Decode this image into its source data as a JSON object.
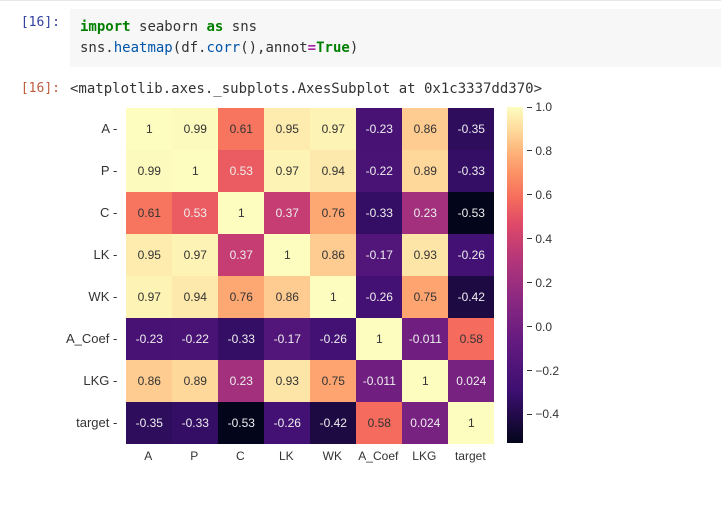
{
  "input_prompt": "[16]:",
  "output_prompt": "[16]:",
  "code": {
    "l1": {
      "kw_import": "import",
      "mod": "seaborn",
      "kw_as": "as",
      "alias": "sns"
    },
    "l2": {
      "obj": "sns",
      "fn1": "heatmap",
      "arg1a": "df",
      "fn2": "corr",
      "kw_annot": "annot",
      "op_eq": "=",
      "kw_true": "True"
    }
  },
  "output_text": "<matplotlib.axes._subplots.AxesSubplot at 0x1c3337dd370>",
  "chart_data": {
    "type": "heatmap",
    "title": "",
    "labels": [
      "A",
      "P",
      "C",
      "LK",
      "WK",
      "A_Coef",
      "LKG",
      "target"
    ],
    "values": [
      [
        1.0,
        0.99,
        0.61,
        0.95,
        0.97,
        -0.23,
        0.86,
        -0.35
      ],
      [
        0.99,
        1.0,
        0.53,
        0.97,
        0.94,
        -0.22,
        0.89,
        -0.33
      ],
      [
        0.61,
        0.53,
        1.0,
        0.37,
        0.76,
        -0.33,
        0.23,
        -0.53
      ],
      [
        0.95,
        0.97,
        0.37,
        1.0,
        0.86,
        -0.17,
        0.93,
        -0.26
      ],
      [
        0.97,
        0.94,
        0.76,
        0.86,
        1.0,
        -0.26,
        0.75,
        -0.42
      ],
      [
        -0.23,
        -0.22,
        -0.33,
        -0.17,
        -0.26,
        1.0,
        -0.011,
        0.58
      ],
      [
        0.86,
        0.89,
        0.23,
        0.93,
        0.75,
        -0.011,
        1.0,
        0.024
      ],
      [
        -0.35,
        -0.33,
        -0.53,
        -0.26,
        -0.42,
        0.58,
        0.024,
        1.0
      ]
    ],
    "display_values": [
      [
        "1",
        "0.99",
        "0.61",
        "0.95",
        "0.97",
        "-0.23",
        "0.86",
        "-0.35"
      ],
      [
        "0.99",
        "1",
        "0.53",
        "0.97",
        "0.94",
        "-0.22",
        "0.89",
        "-0.33"
      ],
      [
        "0.61",
        "0.53",
        "1",
        "0.37",
        "0.76",
        "-0.33",
        "0.23",
        "-0.53"
      ],
      [
        "0.95",
        "0.97",
        "0.37",
        "1",
        "0.86",
        "-0.17",
        "0.93",
        "-0.26"
      ],
      [
        "0.97",
        "0.94",
        "0.76",
        "0.86",
        "1",
        "-0.26",
        "0.75",
        "-0.42"
      ],
      [
        "-0.23",
        "-0.22",
        "-0.33",
        "-0.17",
        "-0.26",
        "1",
        "-0.011",
        "0.58"
      ],
      [
        "0.86",
        "0.89",
        "0.23",
        "0.93",
        "0.75",
        "-0.011",
        "1",
        "0.024"
      ],
      [
        "-0.35",
        "-0.33",
        "-0.53",
        "-0.26",
        "-0.42",
        "0.58",
        "0.024",
        "1"
      ]
    ],
    "colorbar_ticks": [
      -0.4,
      -0.2,
      0.0,
      0.2,
      0.4,
      0.6,
      0.8,
      1.0
    ],
    "vmin": -0.53,
    "vmax": 1.0,
    "cmap_stops": [
      {
        "t": 0.0,
        "c": "#03051a"
      },
      {
        "t": 0.15,
        "c": "#3b0f70"
      },
      {
        "t": 0.3,
        "c": "#641a80"
      },
      {
        "t": 0.43,
        "c": "#8c2981"
      },
      {
        "t": 0.55,
        "c": "#b63679"
      },
      {
        "t": 0.65,
        "c": "#de4968"
      },
      {
        "t": 0.73,
        "c": "#f66d5c"
      },
      {
        "t": 0.8,
        "c": "#fb9065"
      },
      {
        "t": 0.87,
        "c": "#feb67c"
      },
      {
        "t": 0.93,
        "c": "#fed99b"
      },
      {
        "t": 1.0,
        "c": "#fcfdbf"
      }
    ]
  },
  "cbar_tick_labels": [
    "1.0",
    "0.8",
    "0.6",
    "0.4",
    "0.2",
    "0.0",
    "−0.2",
    "−0.4"
  ]
}
